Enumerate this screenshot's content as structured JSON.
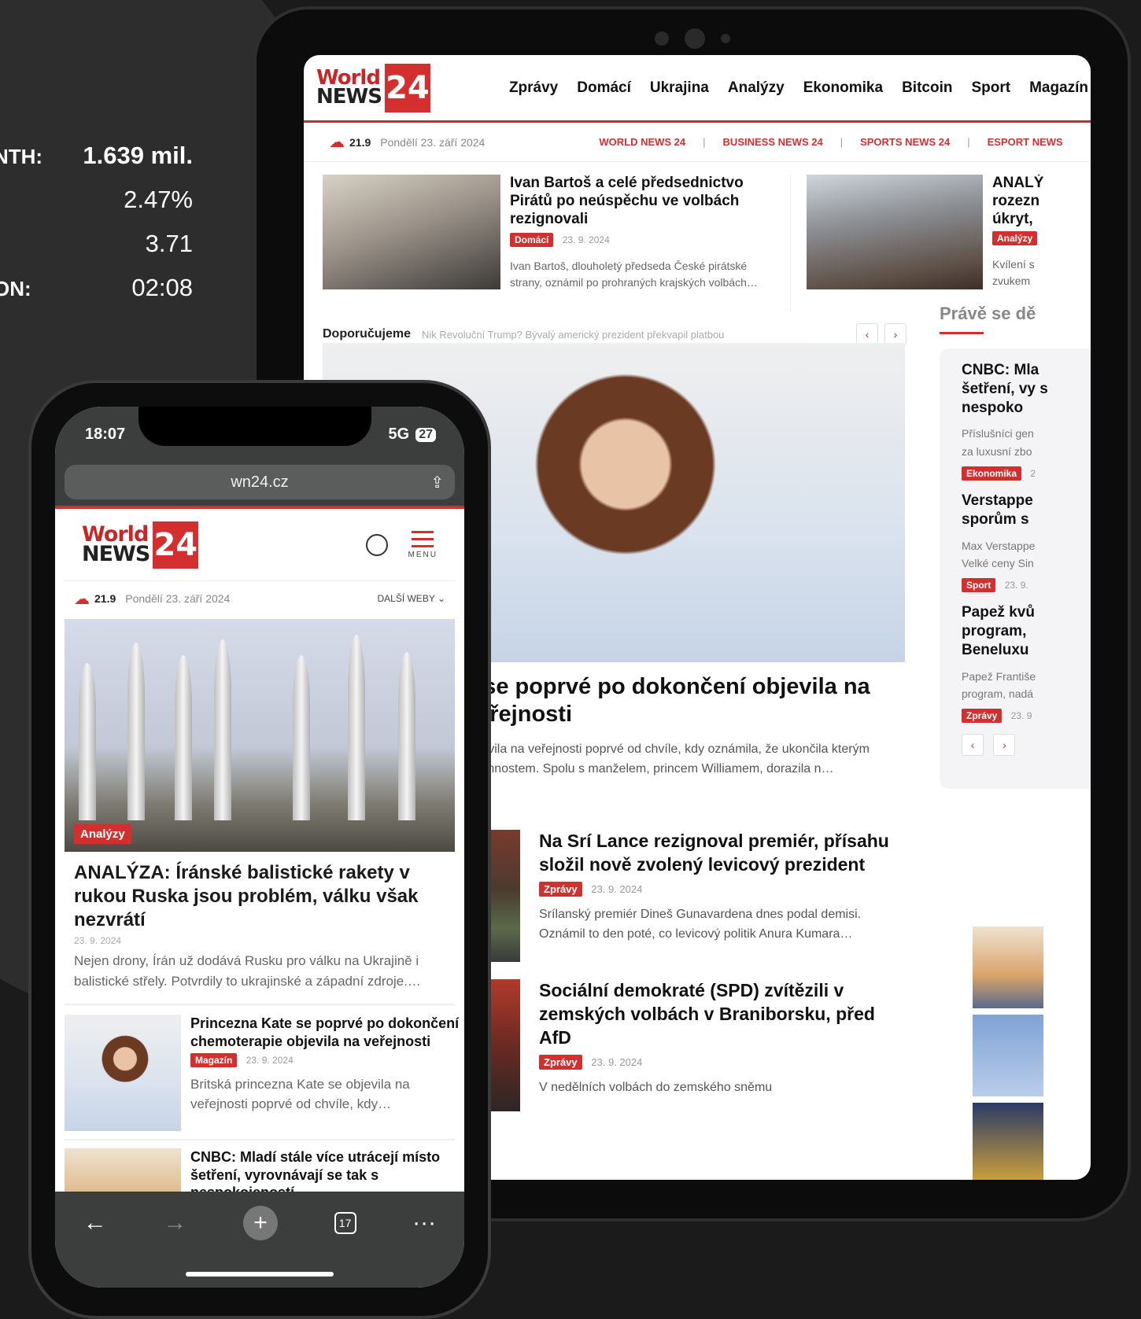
{
  "stats": [
    {
      "label": "NTH:",
      "value": "1.639 mil."
    },
    {
      "label": "",
      "value": "2.47%"
    },
    {
      "label": "",
      "value": "3.71"
    },
    {
      "label": "ON:",
      "value": "02:08"
    }
  ],
  "brand": {
    "logo_world": "World",
    "logo_news": "NEWS",
    "logo_num": "24",
    "accent": "#d32f2f"
  },
  "tablet": {
    "nav": [
      "Zprávy",
      "Domácí",
      "Ukrajina",
      "Analýzy",
      "Ekonomika",
      "Bitcoin",
      "Sport",
      "Magazín"
    ],
    "weather": {
      "temp": "21.9",
      "date": "Pondělí 23. září 2024"
    },
    "sites": [
      "WORLD NEWS 24",
      "BUSINESS NEWS 24",
      "SPORTS NEWS 24",
      "ESPORT NEWS"
    ],
    "top_cards": [
      {
        "title": "Ivan Bartoš a celé předsednictvo Pirátů po neúspěchu ve volbách rezignovali",
        "badge": "Domácí",
        "date": "23. 9. 2024",
        "excerpt": "Ivan Bartoš, dlouholetý předseda České pirátské strany, oznámil po prohraných krajských volbách…"
      },
      {
        "title": "ANALÝ rozezn úkryt,",
        "badge": "Analýzy",
        "excerpt": "Kvílení s zvukem"
      }
    ],
    "recommend": {
      "label": "Doporučujeme",
      "ticker": "Nik Revoluční Trump? Bývalý americký prezident překvapil platbou"
    },
    "hero": {
      "title": "e se poprvé po dokončení objevila na veřejnosti",
      "excerpt": "objevila na veřejnosti poprvé od chvíle, kdy oznámila, že ukončila kterým povinnostem. Spolu s manželem, princem Williamem, dorazila n…"
    },
    "list": [
      {
        "title": "Na Srí Lance rezignoval premiér, přísahu složil nově zvolený levicový prezident",
        "badge": "Zprávy",
        "date": "23. 9. 2024",
        "excerpt": "Srílanský premiér Dineš Gunavardena dnes podal demisi. Oznámil to den poté, co levicový politik Anura Kumara…"
      },
      {
        "title": "Sociální demokraté (SPD) zvítězili v zemských volbách v Braniborsku, před AfD",
        "badge": "Zprávy",
        "date": "23. 9. 2024",
        "excerpt": "V nedělních volbách do zemského sněmu"
      }
    ],
    "sidebar": {
      "heading": "Právě se dě",
      "items": [
        {
          "title": "CNBC: Mla šetření, vy s nespoko",
          "excerpt": "Příslušníci gen za luxusní zbo",
          "badge": "Ekonomika",
          "date": "2"
        },
        {
          "title": "Verstappe sporům s",
          "excerpt": "Max Verstappe Velké ceny Sin",
          "badge": "Sport",
          "date": "23. 9."
        },
        {
          "title": "Papež kvů program, Beneluxu",
          "excerpt": "Papež Františe program, nadá",
          "badge": "Zprávy",
          "date": "23. 9"
        }
      ]
    }
  },
  "phone": {
    "time": "18:07",
    "network": "5G",
    "battery": "27",
    "url": "wn24.cz",
    "menu_label": "MENU",
    "weather": {
      "temp": "21.9",
      "date": "Pondělí 23. září 2024"
    },
    "more_sites": "DALŠÍ WEBY",
    "hero": {
      "badge": "Analýzy",
      "title": "ANALÝZA: Íránské balistické rakety v rukou Ruska jsou problém, válku však nezvrátí",
      "date": "23. 9. 2024",
      "excerpt": "Nejen drony, Írán už dodává Rusku pro válku na Ukrajině i balistické střely. Potvrdily to ukrajinské a západní zdroje.…"
    },
    "items": [
      {
        "title": "Princezna Kate se poprvé po dokončení chemoterapie objevila na veřejnosti",
        "badge": "Magazín",
        "date": "23. 9. 2024",
        "excerpt": "Britská princezna Kate se objevila na veřejnosti poprvé od chvíle, kdy…"
      },
      {
        "title": "CNBC: Mladí stále více utrácejí místo šetření, vyrovnávají se tak s nespokojeností"
      }
    ],
    "tab_count": "17"
  }
}
